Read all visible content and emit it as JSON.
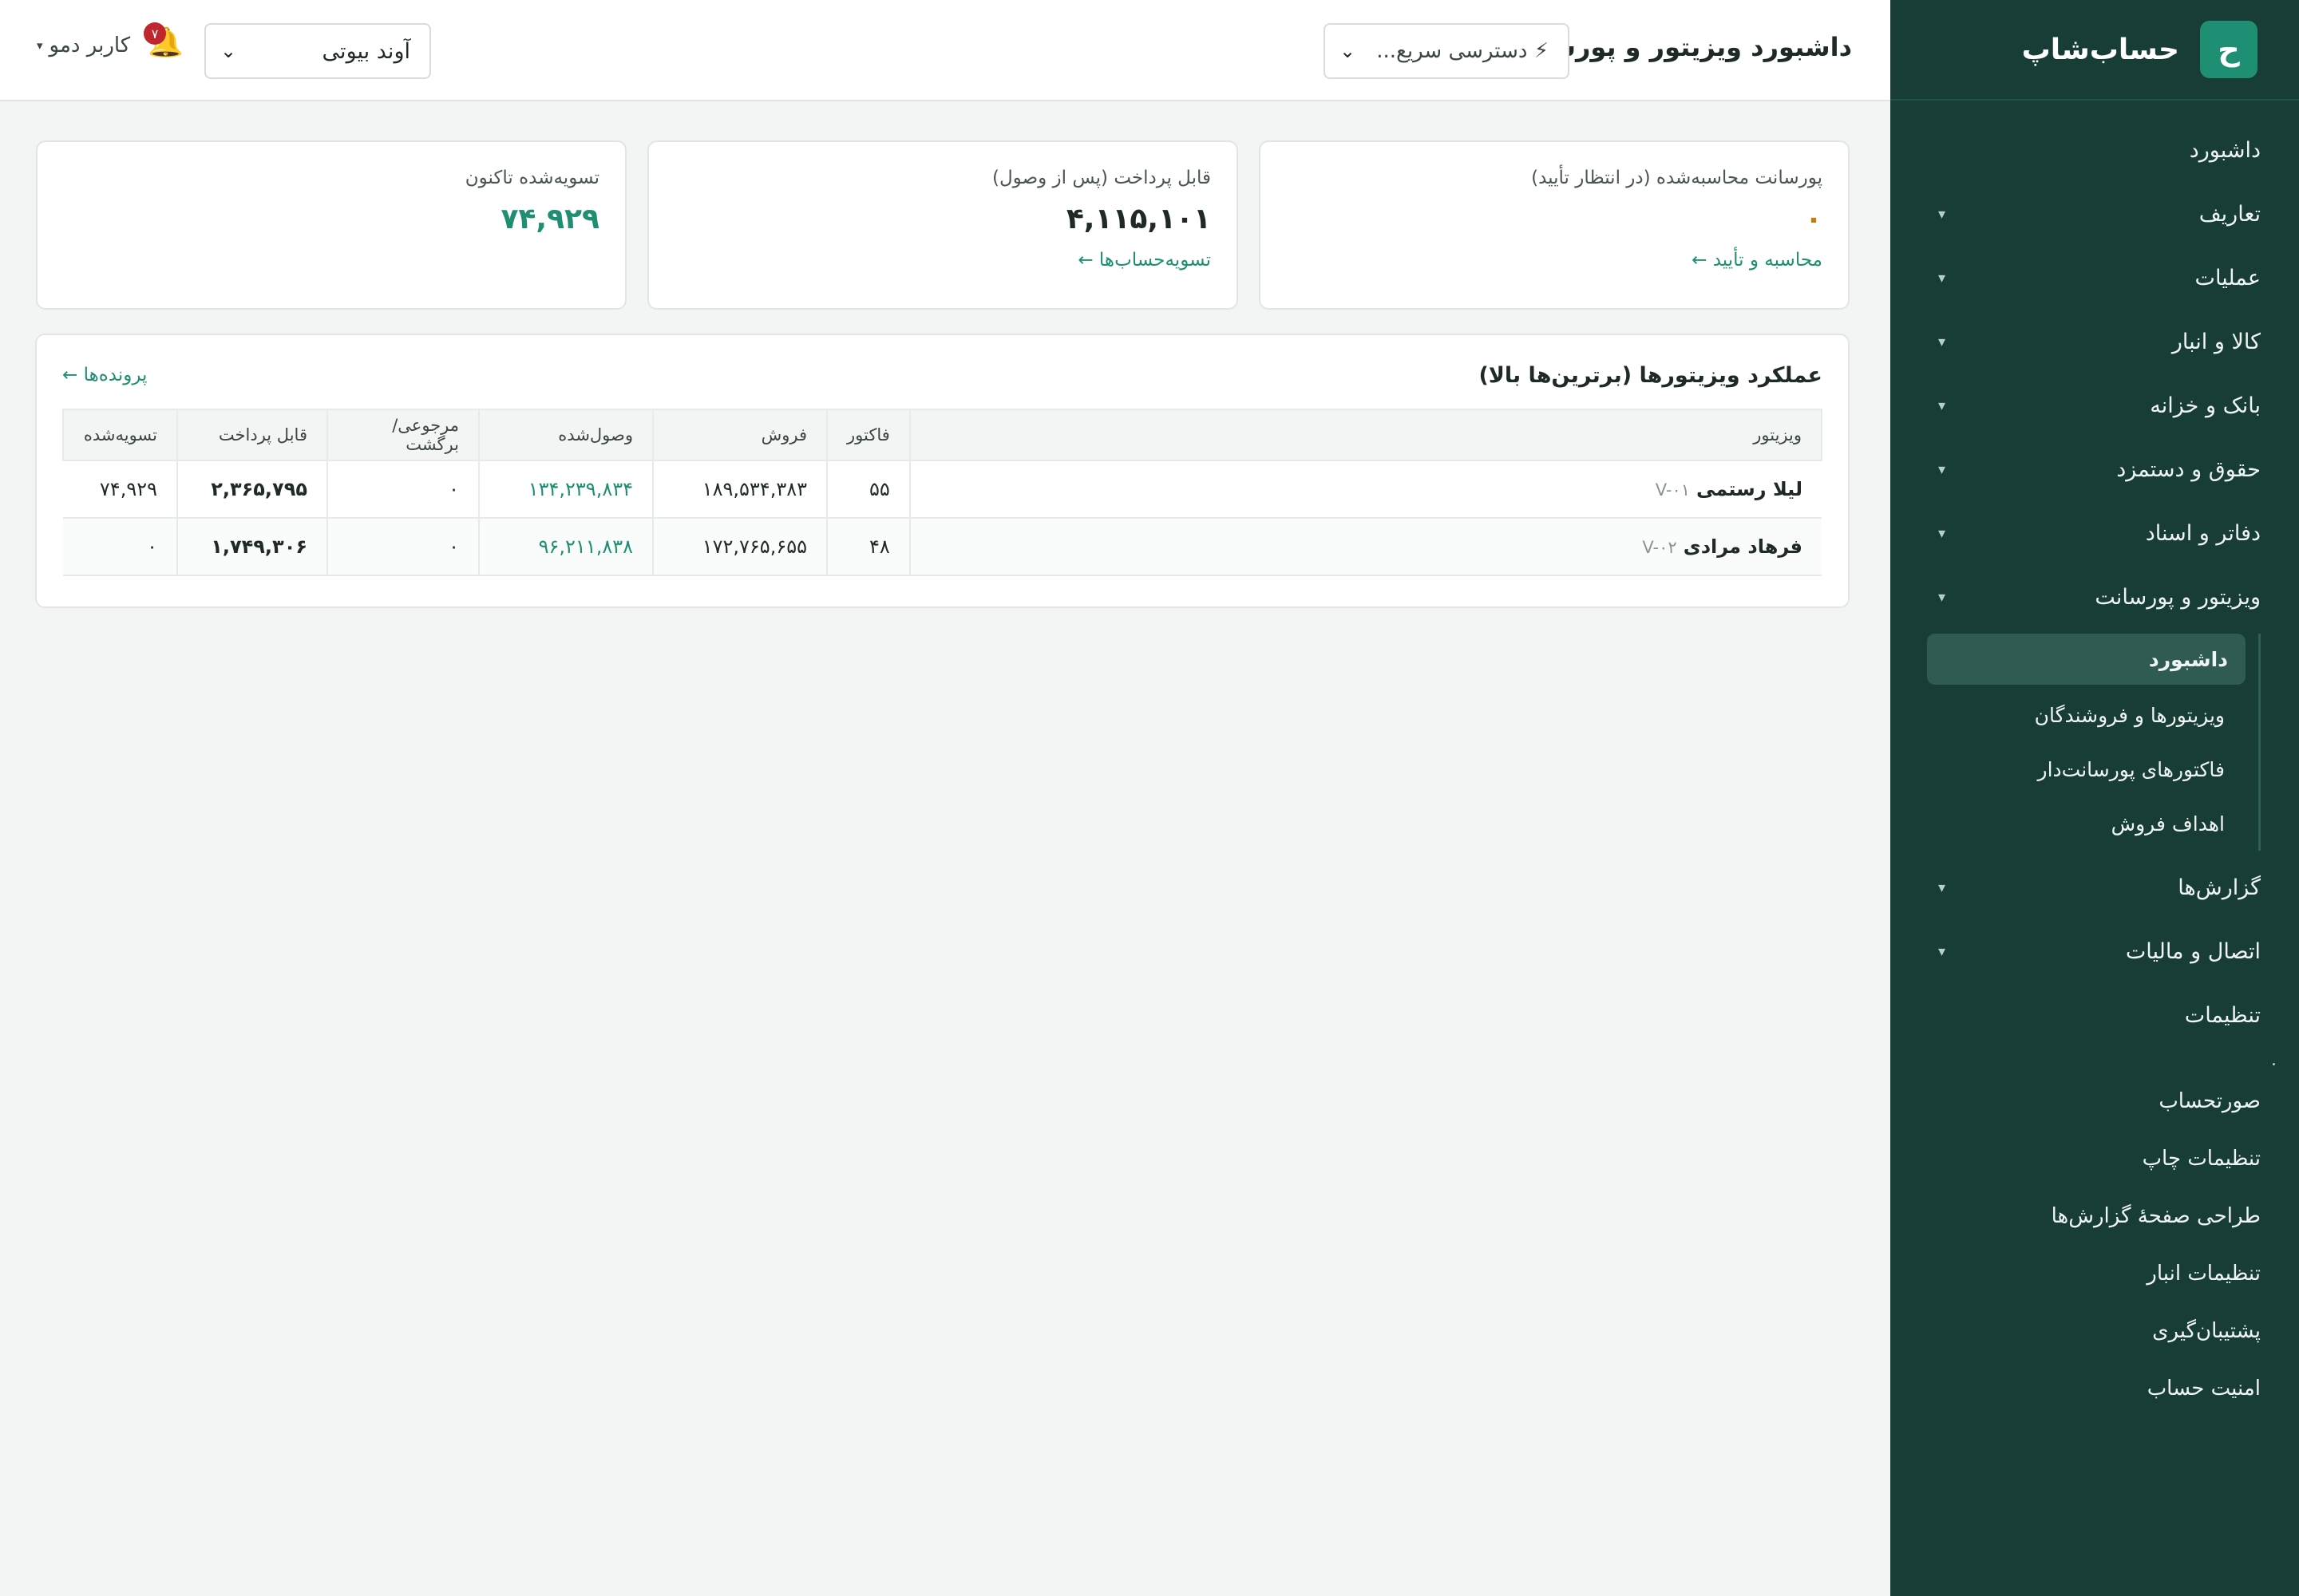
{
  "brand": {
    "logo_letter": "ح",
    "name": "حساب‌شاپ"
  },
  "sidebar": {
    "items": [
      {
        "label": "داشبورد",
        "caret": ""
      },
      {
        "label": "تعاریف",
        "caret": "▾"
      },
      {
        "label": "عملیات",
        "caret": "▾"
      },
      {
        "label": "کالا و انبار",
        "caret": "▾"
      },
      {
        "label": "بانک و خزانه",
        "caret": "▾"
      },
      {
        "label": "حقوق و دستمزد",
        "caret": "▾"
      },
      {
        "label": "دفاتر و اسناد",
        "caret": "▾"
      },
      {
        "label": "ویزیتور و پورسانت",
        "caret": "▾"
      }
    ],
    "sub_items": [
      {
        "label": "داشبورد"
      },
      {
        "label": "ویزیتورها و فروشندگان"
      },
      {
        "label": "فاکتورهای پورسانت‌دار"
      },
      {
        "label": "اهداف فروش"
      }
    ],
    "items2": [
      {
        "label": "گزارش‌ها",
        "caret": "▾"
      },
      {
        "label": "اتصال و مالیات",
        "caret": "▾"
      },
      {
        "label": "تنظیمات",
        "caret": ""
      }
    ],
    "dot": ".",
    "items3": [
      {
        "label": "صورتحساب"
      },
      {
        "label": "تنظیمات چاپ"
      },
      {
        "label": "طراحی صفحهٔ گزارش‌ها"
      },
      {
        "label": "تنظیمات انبار"
      },
      {
        "label": "پشتیبان‌گیری"
      },
      {
        "label": "امنیت حساب"
      }
    ]
  },
  "topbar": {
    "title": "داشبورد ویزیتور و پورسانت",
    "quick_access": "⚡ دسترسی سریع...",
    "store": "آوند بیوتی",
    "notifications_count": "۷",
    "user": "کاربر دمو"
  },
  "kpis": [
    {
      "label": "پورسانت محاسبه‌شده (در انتظار تأیید)",
      "value": "۰",
      "link": "محاسبه و تأیید ←"
    },
    {
      "label": "قابل پرداخت (پس از وصول)",
      "value": "۴,۱۱۵,۱۰۱",
      "link": "تسویه‌حساب‌ها ←"
    },
    {
      "label": "تسویه‌شده تاکنون",
      "value": "۷۴,۹۲۹",
      "link": ""
    }
  ],
  "panel": {
    "title": "عملکرد ویزیتورها (برترین‌ها بالا)",
    "link": "پرونده‌ها ←",
    "columns": [
      "ویزیتور",
      "فاکتور",
      "فروش",
      "وصول‌شده",
      "مرجوعی/برگشت",
      "قابل پرداخت",
      "تسویه‌شده"
    ],
    "rows": [
      {
        "name": "لیلا رستمی",
        "code": "V-۰۱",
        "invoices": "۵۵",
        "sales": "۱۸۹,۵۳۴,۳۸۳",
        "collected": "۱۳۴,۲۳۹,۸۳۴",
        "returns": "۰",
        "payable": "۲,۳۶۵,۷۹۵",
        "settled": "۷۴,۹۲۹"
      },
      {
        "name": "فرهاد مرادی",
        "code": "V-۰۲",
        "invoices": "۴۸",
        "sales": "۱۷۲,۷۶۵,۶۵۵",
        "collected": "۹۶,۲۱۱,۸۳۸",
        "returns": "۰",
        "payable": "۱,۷۴۹,۳۰۶",
        "settled": "۰"
      }
    ]
  },
  "colors": {
    "sidebar_bg": "#173d36",
    "accent": "#1f8f73",
    "pending": "#c87a10",
    "badge": "#c0262d"
  }
}
